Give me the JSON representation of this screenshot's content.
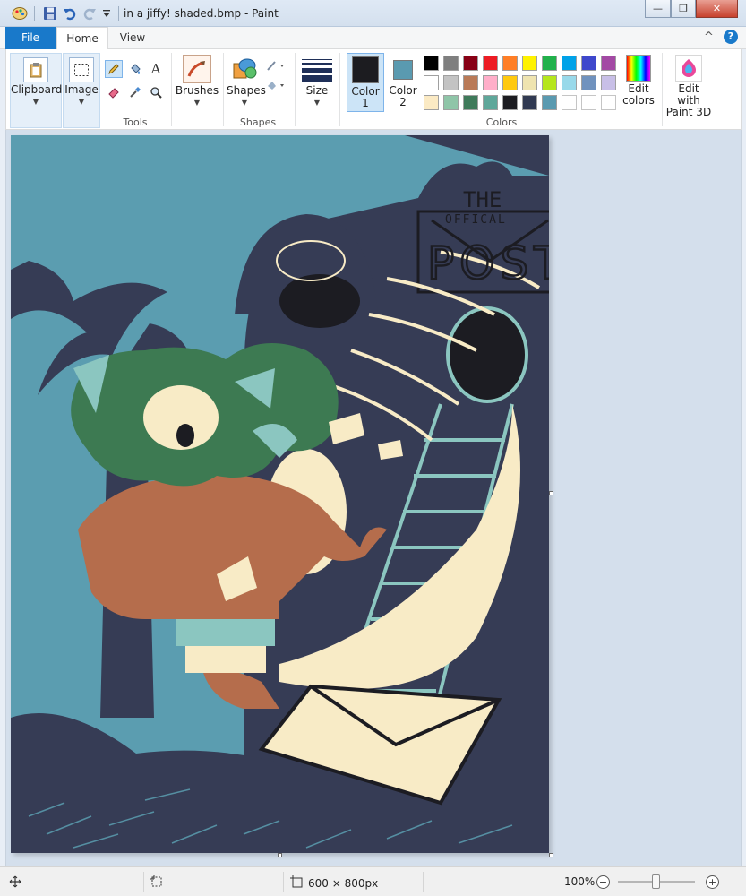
{
  "window": {
    "title": "in a jiffy! shaded.bmp - Paint",
    "minimize_glyph": "—",
    "restore_glyph": "❐",
    "close_glyph": "✕"
  },
  "tabs": {
    "file": "File",
    "home": "Home",
    "view": "View",
    "collapse_glyph": "^",
    "help_glyph": "?"
  },
  "ribbon": {
    "clipboard": {
      "label": "Clipboard"
    },
    "image": {
      "label": "Image"
    },
    "tools": {
      "group_label": "Tools"
    },
    "brushes": {
      "label": "Brushes"
    },
    "shapes": {
      "label": "Shapes",
      "group_label": "Shapes"
    },
    "size": {
      "label": "Size"
    },
    "color1": {
      "label_line1": "Color",
      "label_line2": "1",
      "value": "#1c1c20"
    },
    "color2": {
      "label_line1": "Color",
      "label_line2": "2",
      "value": "#5a9ab0"
    },
    "colors_group_label": "Colors",
    "edit_colors": {
      "label_line1": "Edit",
      "label_line2": "colors"
    },
    "paint3d": {
      "label_line1": "Edit with",
      "label_line2": "Paint 3D"
    },
    "text_tool_glyph": "A",
    "palette": [
      [
        "#000000",
        "#7f7f7f",
        "#880015",
        "#ed1c24",
        "#ff7f27",
        "#fff200",
        "#22b14c",
        "#00a2e8",
        "#3f48cc",
        "#a349a4"
      ],
      [
        "#ffffff",
        "#c3c3c3",
        "#b97a57",
        "#ffaec9",
        "#ffc90e",
        "#efe4b0",
        "#b5e61d",
        "#99d9ea",
        "#7092be",
        "#c8bfe7"
      ],
      [
        "#fbeac4",
        "#8fc5a8",
        "#3f7a5a",
        "#5fa79a",
        "#1c1c20",
        "#313a52",
        "#5a9ab0",
        "",
        "",
        ""
      ]
    ]
  },
  "canvas_colors": {
    "sky": "#5b9db0",
    "navy": "#363c55",
    "cream": "#f8ebc6",
    "rust": "#b56d4c",
    "green": "#3d7a52",
    "teal": "#8bc6c0",
    "dark": "#1c1c22"
  },
  "painting_text": {
    "sign_the": "THE",
    "sign_offical": "OFFICAL",
    "sign_post": "POST"
  },
  "status": {
    "dimensions": "600 × 800px",
    "zoom": "100%"
  }
}
